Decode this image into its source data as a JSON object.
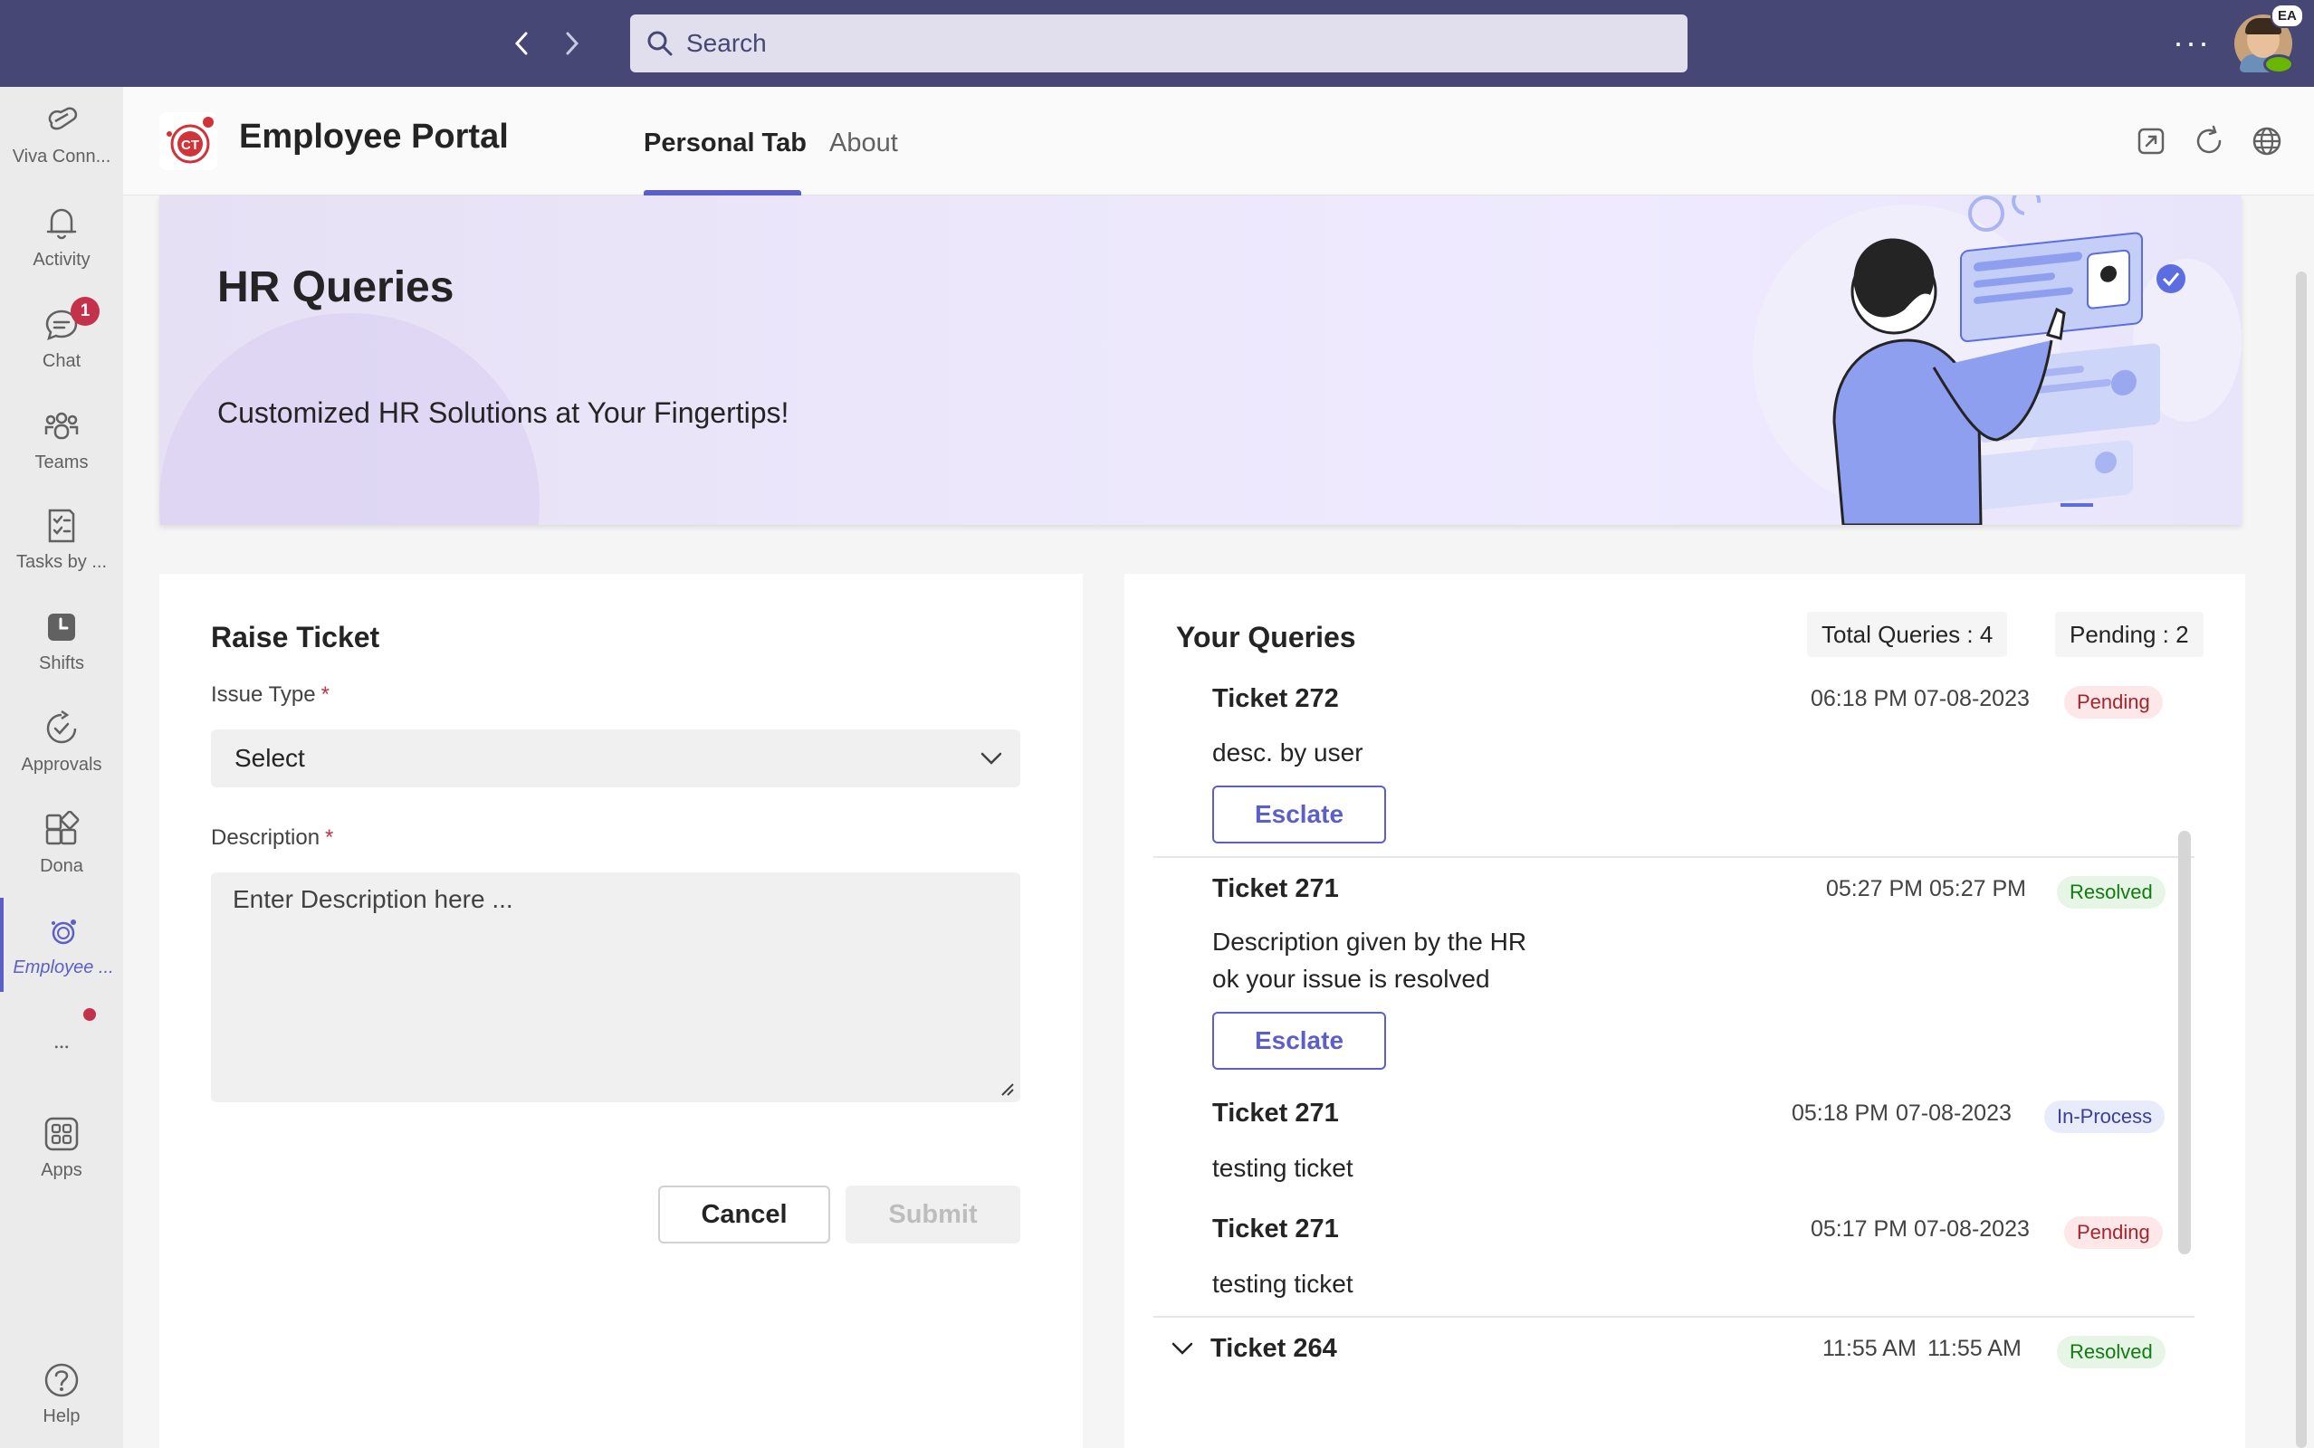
{
  "topbar": {
    "search_placeholder": "Search",
    "account_initials": "EA"
  },
  "rail": {
    "items": [
      {
        "label": "Viva Conn...",
        "icon": "viva-connections-icon"
      },
      {
        "label": "Activity",
        "icon": "bell-icon"
      },
      {
        "label": "Chat",
        "icon": "chat-icon",
        "badge": "1"
      },
      {
        "label": "Teams",
        "icon": "teams-icon"
      },
      {
        "label": "Tasks by ...",
        "icon": "tasks-icon"
      },
      {
        "label": "Shifts",
        "icon": "shifts-icon"
      },
      {
        "label": "Approvals",
        "icon": "approvals-icon"
      },
      {
        "label": "Dona",
        "icon": "apps-grid-plus-icon"
      },
      {
        "label": "Employee ...",
        "icon": "employee-portal-icon"
      },
      {
        "label": "Apps",
        "icon": "apps-icon"
      },
      {
        "label": "Help",
        "icon": "help-icon"
      }
    ]
  },
  "app": {
    "title": "Employee Portal",
    "logo_text": "CT",
    "tabs": [
      "Personal Tab",
      "About"
    ],
    "accent_color": "#5b5fc7"
  },
  "banner": {
    "title": "HR Queries",
    "subtitle": "Customized HR Solutions at Your Fingertips!"
  },
  "raise": {
    "title": "Raise Ticket",
    "issue_label": "Issue Type",
    "required_mark": "*",
    "issue_value": "Select",
    "desc_label": "Description",
    "desc_placeholder": "Enter Description here ...",
    "cancel_label": "Cancel",
    "submit_label": "Submit"
  },
  "queries": {
    "title": "Your Queries",
    "total_label": "Total Queries : 4",
    "pending_label": "Pending : 2",
    "escalate_label": "Esclate",
    "tickets": [
      {
        "title": "Ticket 272",
        "time": "06:18 PM",
        "date": "07-08-2023",
        "status": "Pending",
        "desc": "desc. by user"
      },
      {
        "title": "Ticket 271",
        "time": "05:27 PM",
        "date": "05:27 PM",
        "status": "Resolved",
        "desc1": "Description given by the HR",
        "desc2": "ok your issue is resolved"
      },
      {
        "title": "Ticket 271",
        "time": "05:18 PM",
        "date": "07-08-2023",
        "status": "In-Process",
        "desc": "testing ticket"
      },
      {
        "title": "Ticket 271",
        "time": "05:17 PM",
        "date": "07-08-2023",
        "status": "Pending",
        "desc": "testing ticket"
      },
      {
        "title": "Ticket 264",
        "time": "11:55 AM",
        "date": "11:55 AM",
        "status": "Resolved"
      }
    ]
  }
}
